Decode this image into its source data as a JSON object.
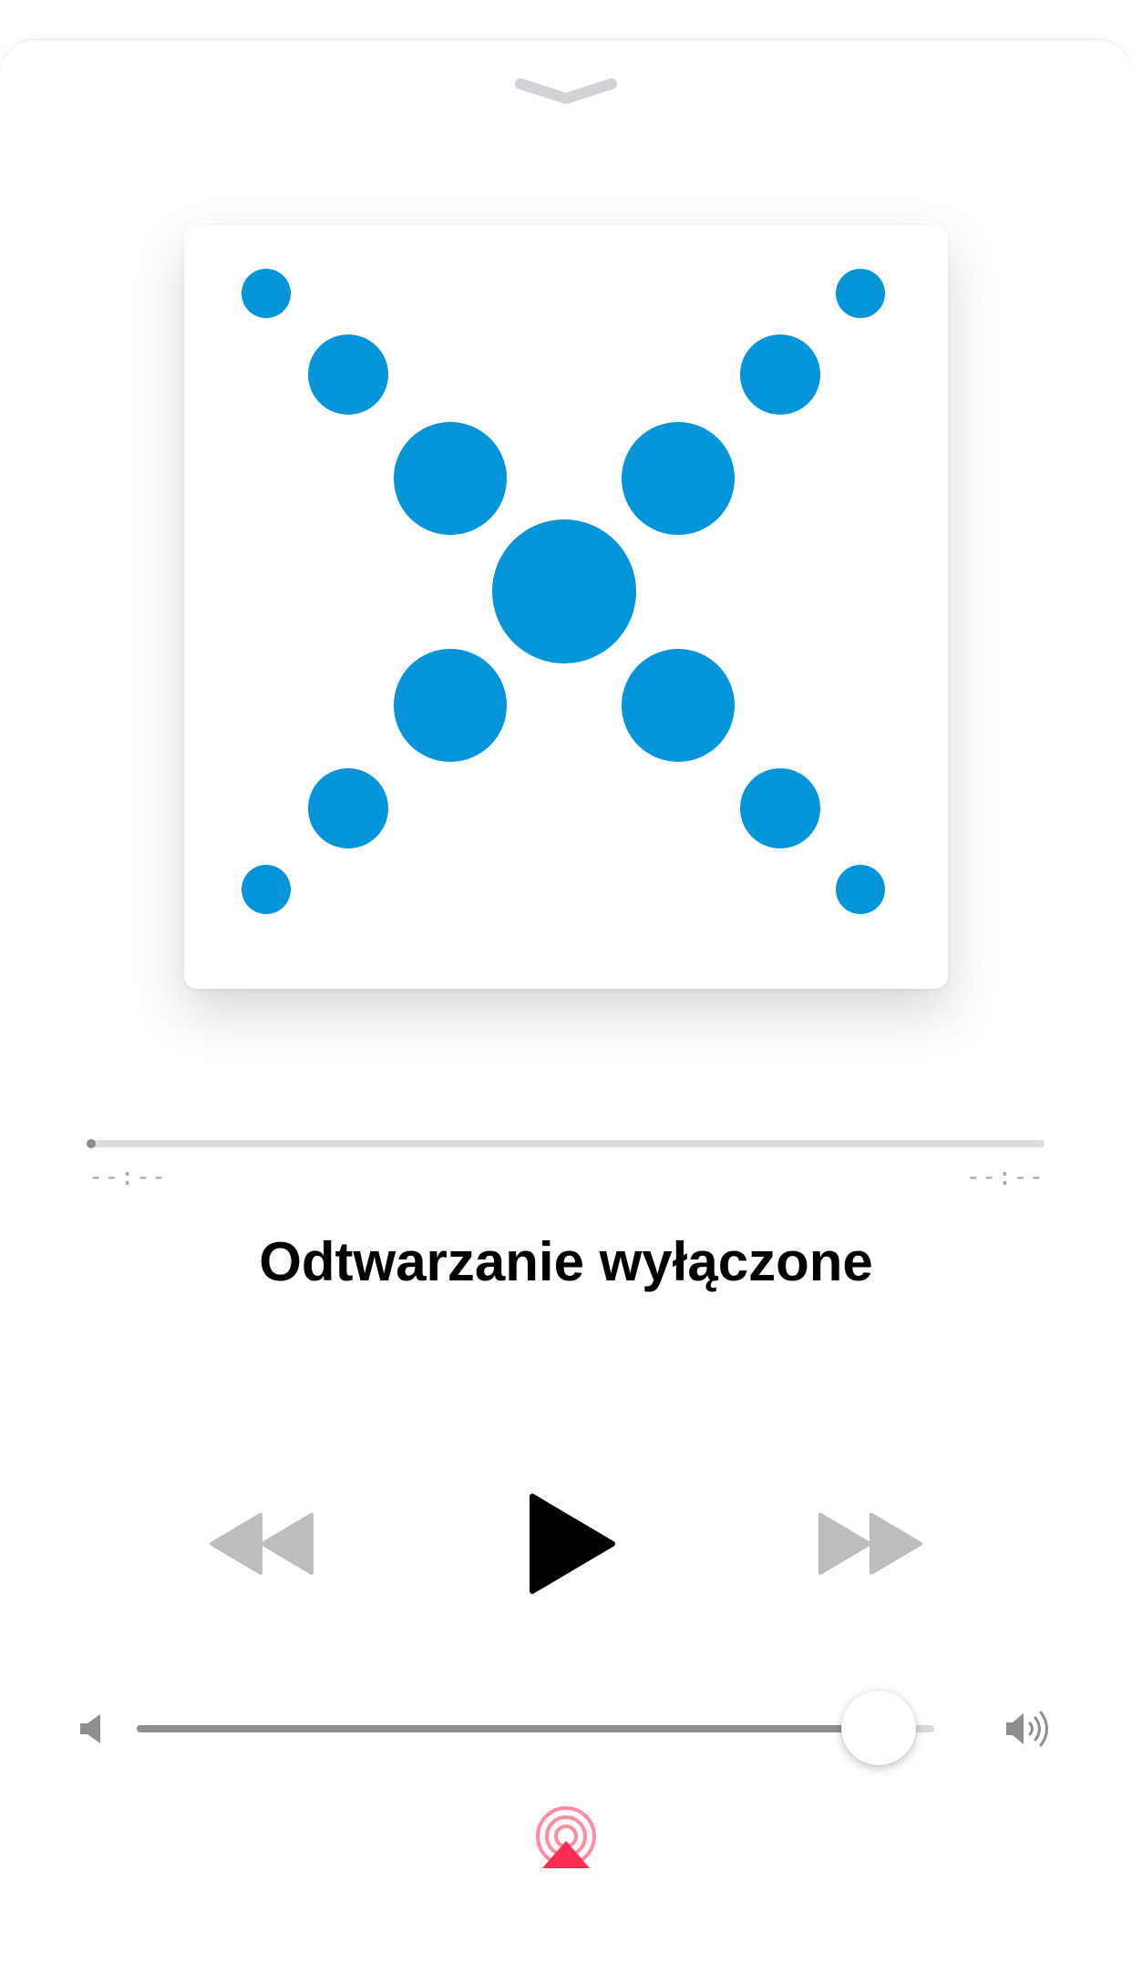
{
  "player": {
    "status_title": "Odtwarzanie wyłączone",
    "elapsed_time": "--:--",
    "remaining_time": "--:--",
    "progress": 0,
    "volume": 0.93
  },
  "icons": {
    "grabber": "chevron-down-icon",
    "artwork": "dots-x-logo",
    "rewind": "rewind-icon",
    "play": "play-icon",
    "forward": "fast-forward-icon",
    "volume_min": "speaker-low-icon",
    "volume_max": "speaker-high-icon",
    "airplay": "airplay-icon"
  },
  "colors": {
    "artwork_dots": "#0394d9",
    "airplay": "#ff2d55",
    "disabled_control": "#bdbdbd",
    "play": "#000000"
  }
}
